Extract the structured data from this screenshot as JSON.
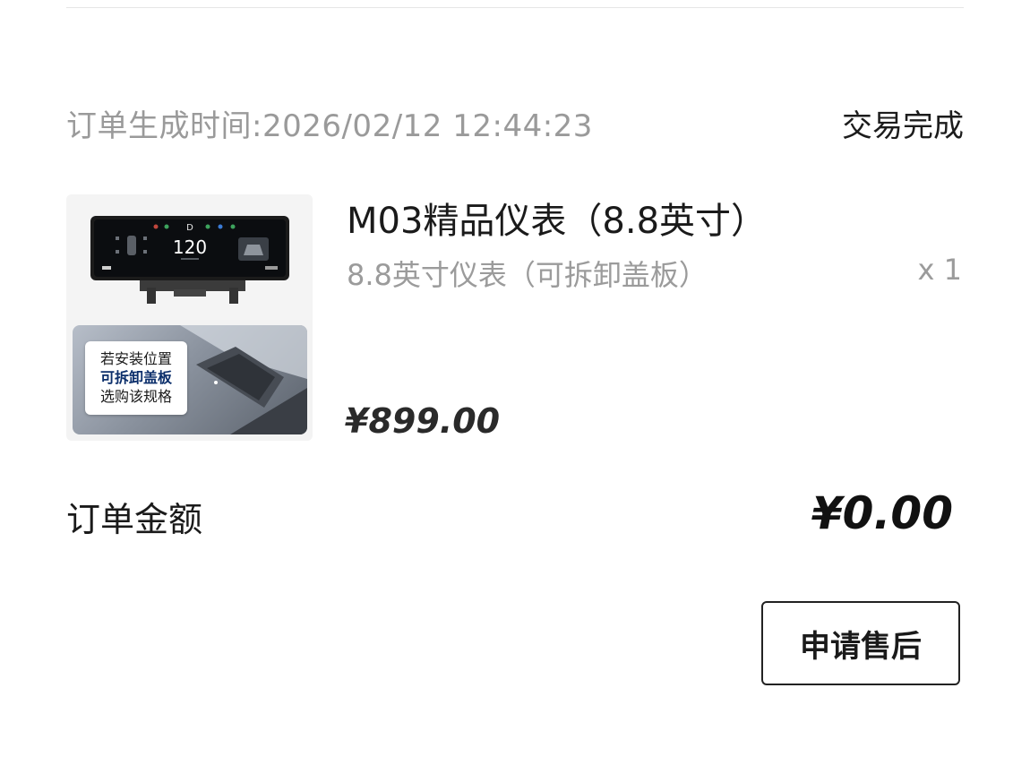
{
  "order": {
    "time_label": "订单生成时间:2026/02/12 12:44:23",
    "status": "交易完成"
  },
  "product": {
    "title": "M03精品仪表（8.8英寸）",
    "spec": "8.8英寸仪表（可拆卸盖板）",
    "quantity": "x 1",
    "price": "¥899.00",
    "image": {
      "speed": "120",
      "gear": "D",
      "note_lines": [
        "若安装位置",
        "可拆卸盖板",
        "选购该规格"
      ]
    }
  },
  "summary": {
    "total_label": "订单金额",
    "total_amount": "¥0.00"
  },
  "actions": {
    "after_sale_label": "申请售后"
  },
  "colors": {
    "muted_text": "#9a9a9a",
    "primary_text": "#1a1a1a",
    "note_highlight": "#0c2f6b"
  }
}
